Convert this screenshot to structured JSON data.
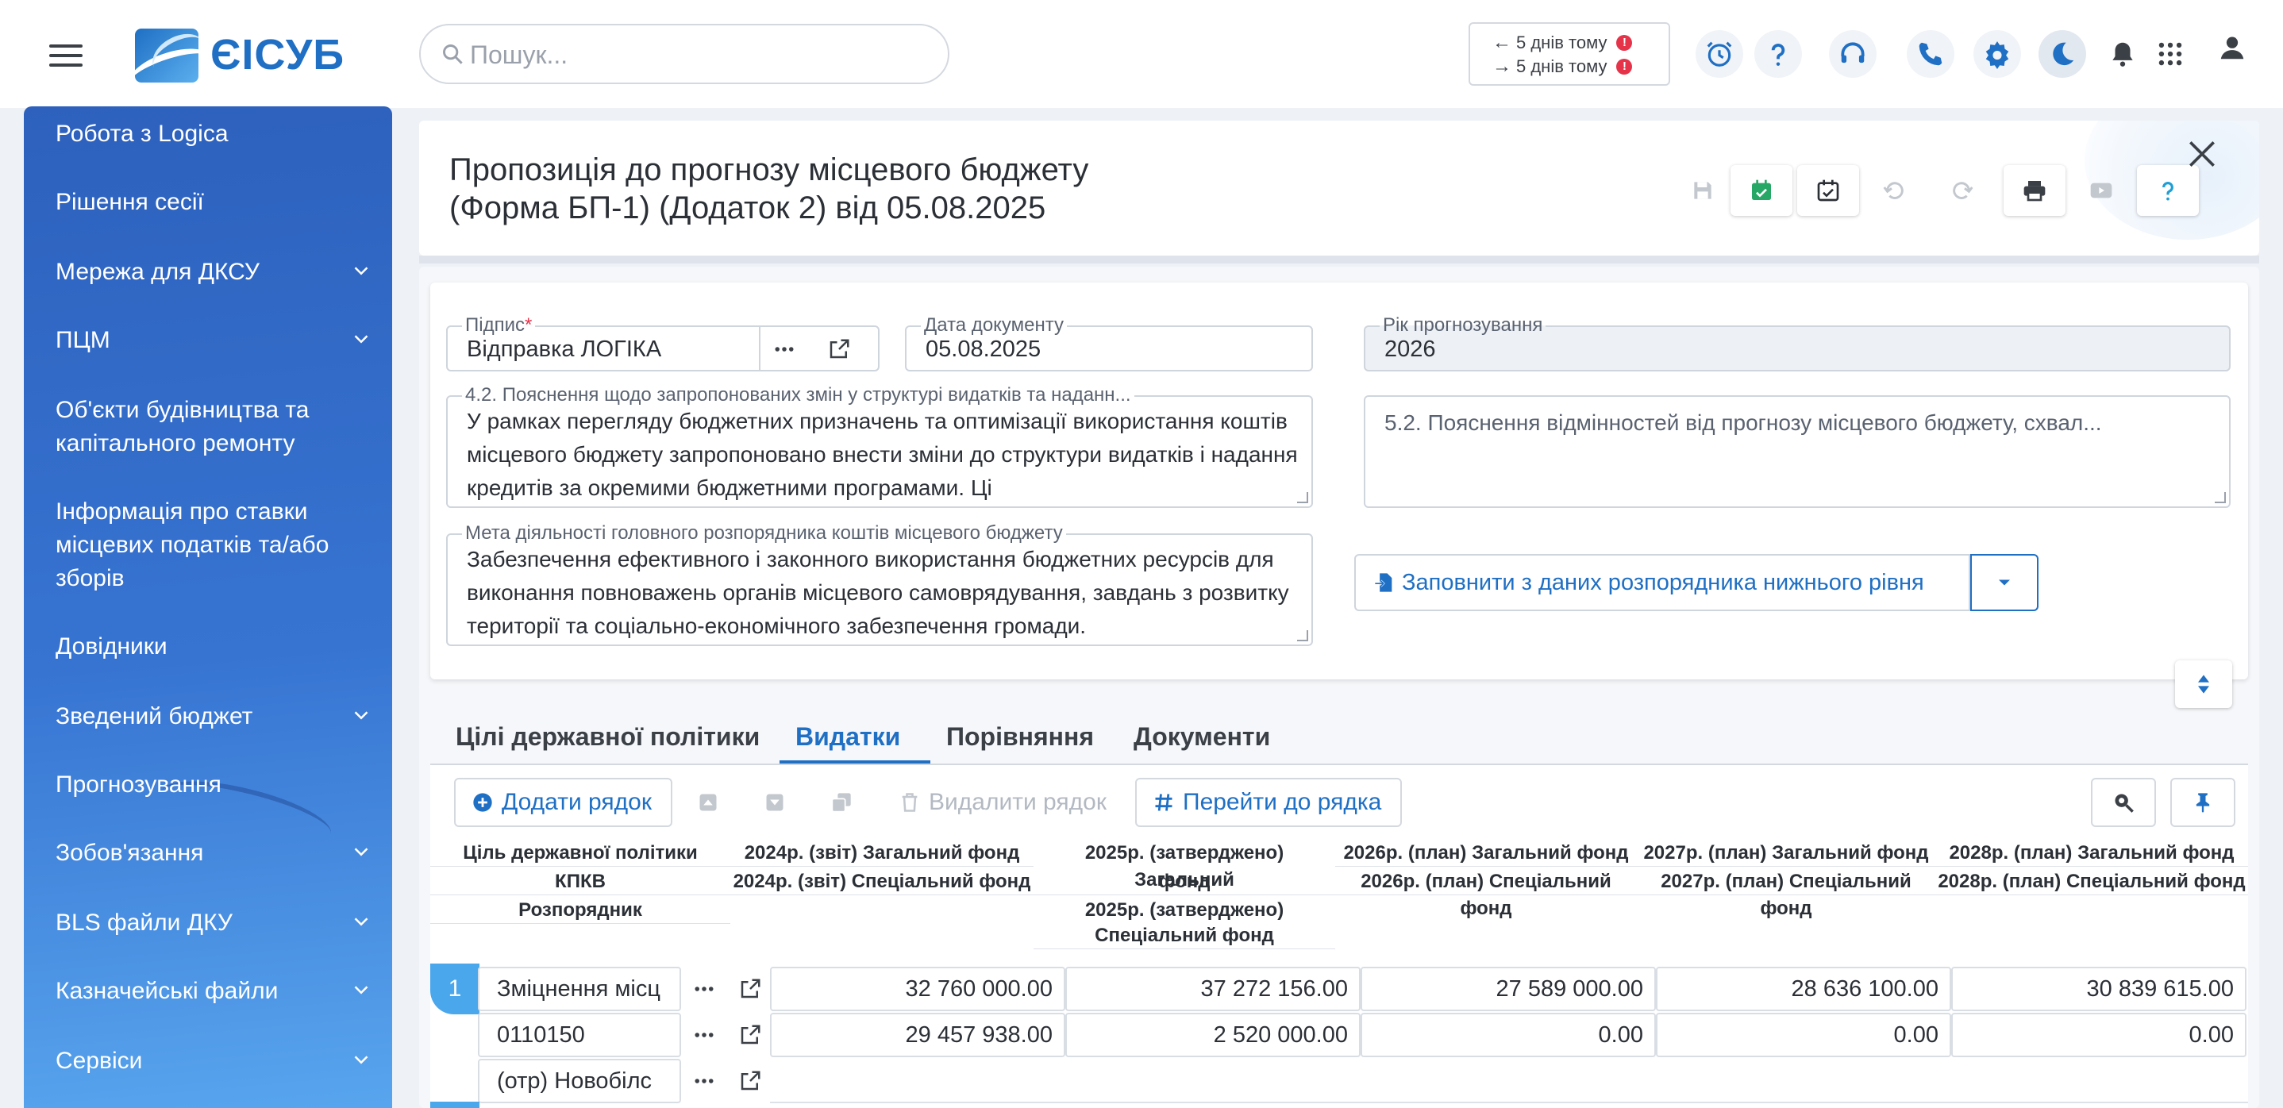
{
  "app": {
    "logo_text": "ЄІСУБ",
    "search_placeholder": "Пошук...",
    "sync": {
      "incoming": "5 днів тому",
      "outgoing": "5 днів тому",
      "alert": "!"
    },
    "header_icons": [
      "alarm-clock-icon",
      "question-icon",
      "headset-icon",
      "phone-icon",
      "gear-icon",
      "moon-icon",
      "bell-icon",
      "apps-grid-icon",
      "user-icon"
    ]
  },
  "sidebar": {
    "items": [
      {
        "label": "Робота з Logica",
        "has_children": false
      },
      {
        "label": "Рішення сесії",
        "has_children": false
      },
      {
        "label": "Мережа для ДКСУ",
        "has_children": true
      },
      {
        "label": "ПЦМ",
        "has_children": true
      },
      {
        "label": "Об'єкти будівництва та капітального ремонту",
        "has_children": false
      },
      {
        "label": "Інформація про ставки місцевих податків та/або зборів",
        "has_children": false
      },
      {
        "label": "Довідники",
        "has_children": false
      },
      {
        "label": "Зведений бюджет",
        "has_children": true
      },
      {
        "label": "Прогнозування",
        "has_children": false
      },
      {
        "label": "Зобов'язання",
        "has_children": true
      },
      {
        "label": "BLS файли ДКУ",
        "has_children": true
      },
      {
        "label": "Казначейські файли",
        "has_children": true
      },
      {
        "label": "Сервіси",
        "has_children": true
      }
    ]
  },
  "document": {
    "title_line1": "Пропозиція до прогнозу місцевого бюджету",
    "title_line2": "(Форма БП-1) (Додаток 2) від 05.08.2025"
  },
  "form": {
    "signature": {
      "label": "Підпис",
      "required_mark": "*",
      "value": "Відправка ЛОГІКА"
    },
    "doc_date": {
      "label": "Дата документу",
      "value": "05.08.2025"
    },
    "forecast_year": {
      "label": "Рік прогнозування",
      "value": "2026"
    },
    "explanation_42": {
      "label": "4.2. Пояснення щодо запропонованих змін у структурі видатків та наданн...",
      "value": "У рамках перегляду бюджетних призначень та оптимізації використання коштів місцевого бюджету запропоновано внести зміни до структури видатків і надання кредитів за окремими бюджетними програмами. Ці"
    },
    "explanation_52": {
      "placeholder": "5.2. Пояснення відмінностей від прогнозу місцевого бюджету, схвал..."
    },
    "goal": {
      "label": "Мета діяльності головного розпорядника коштів місцевого бюджету",
      "value": "Забезпечення ефективного і законного використання бюджетних ресурсів для виконання повноважень органів місцевого самоврядування, завдань з розвитку території та соціально-економічного забезпечення громади."
    },
    "fill_button": "Заповнити з даних розпорядника нижнього рівня"
  },
  "tabs": [
    {
      "label": "Цілі державної політики",
      "active": false
    },
    {
      "label": "Видатки",
      "active": true
    },
    {
      "label": "Порівняння",
      "active": false
    },
    {
      "label": "Документи",
      "active": false
    }
  ],
  "grid_toolbar": {
    "add_row": "Додати рядок",
    "delete_row": "Видалити рядок",
    "goto_row": "Перейти до рядка"
  },
  "grid": {
    "headers": {
      "col1": [
        "Ціль державної політики",
        "КПКВ",
        "Розпорядник"
      ],
      "c2024": [
        "2024р. (звіт) Загальний фонд",
        "2024р. (звіт) Спеціальний фонд"
      ],
      "c2025a": [
        "2025р. (затверджено) Загальний",
        "фонд"
      ],
      "c2025b": [
        "2025р. (затверджено)",
        "Спеціальний фонд"
      ],
      "c2026": [
        "2026р. (план) Загальний фонд",
        "2026р. (план) Спеціальний фонд"
      ],
      "c2027": [
        "2027р. (план) Загальний фонд",
        "2027р. (план) Спеціальний фонд"
      ],
      "c2028": [
        "2028р. (план) Загальний фонд",
        "2028р. (план) Спеціальний фонд"
      ]
    },
    "rows": [
      {
        "number": "1",
        "goal": "Зміцнення місц",
        "kpkv": "0110150",
        "manager": "(отр) Новобілс",
        "general": [
          "32 760 000.00",
          "37 272 156.00",
          "27 589 000.00",
          "28 636 100.00",
          "30 839 615.00"
        ],
        "special": [
          "29 457 938.00",
          "2 520 000.00",
          "0.00",
          "0.00",
          "0.00"
        ]
      }
    ]
  }
}
